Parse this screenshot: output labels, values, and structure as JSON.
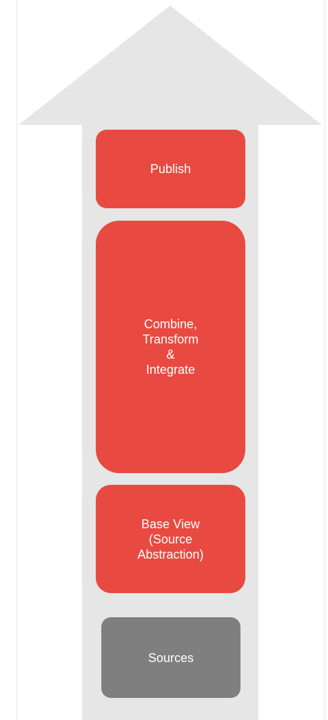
{
  "diagram": {
    "layers": [
      {
        "id": "publish",
        "label": "Publish",
        "color": "#e84a41"
      },
      {
        "id": "combine",
        "label": "Combine,\nTransform\n&\nIntegrate",
        "color": "#e84a41"
      },
      {
        "id": "base",
        "label": "Base View\n(Source\nAbstraction)",
        "color": "#e84a41"
      },
      {
        "id": "sources",
        "label": "Sources",
        "color": "#7f7f7f"
      }
    ],
    "arrow_color": "#e6e6e6"
  }
}
